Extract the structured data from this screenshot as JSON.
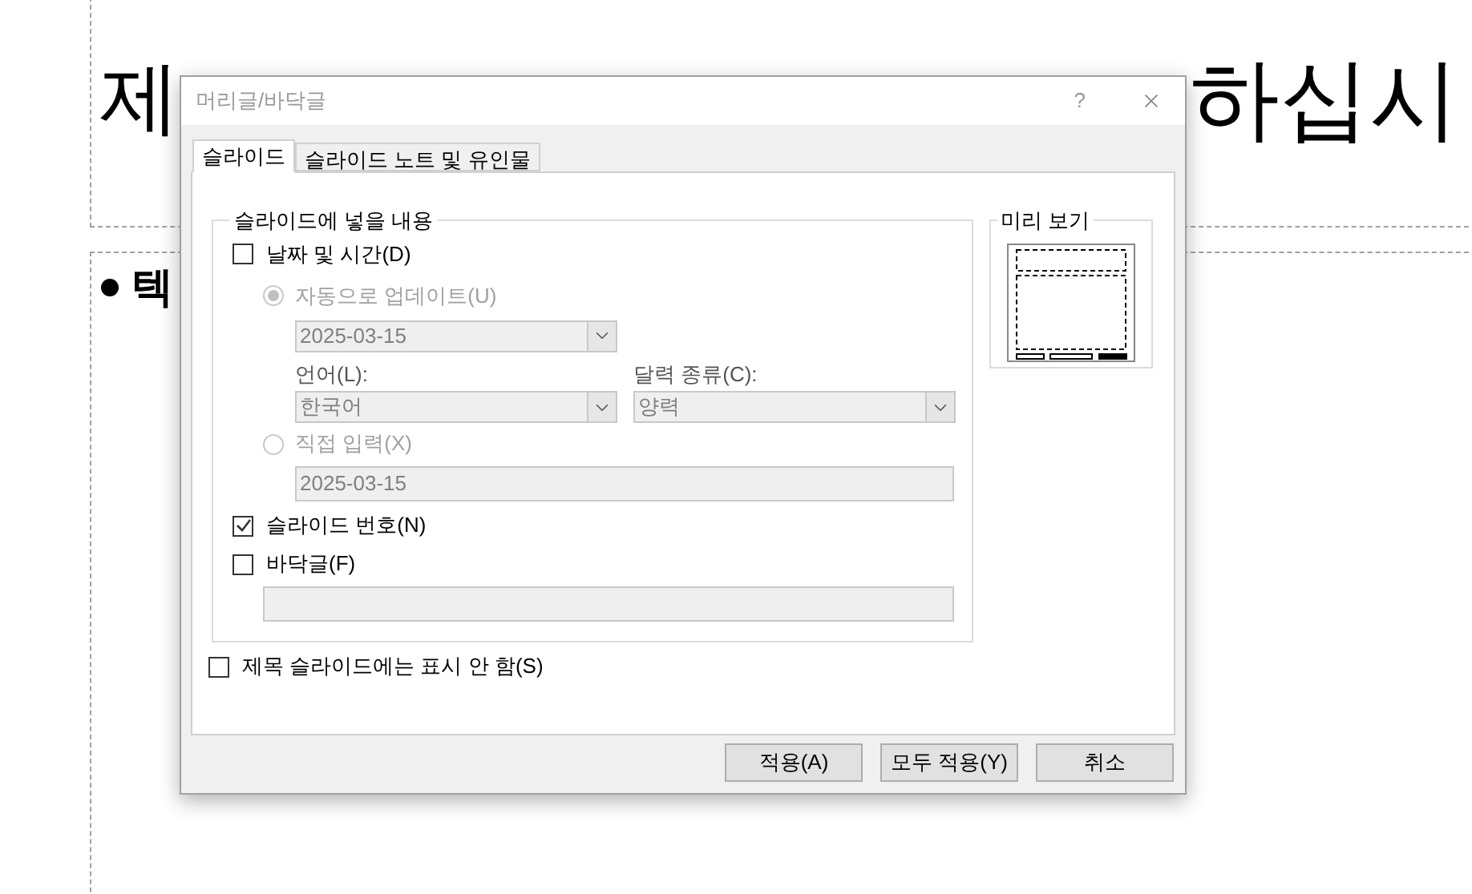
{
  "slide": {
    "title_left": "제",
    "title_right": "하십시",
    "body": "텍"
  },
  "window": {
    "title": "머리글/바닥글",
    "help": "?"
  },
  "tabs": [
    {
      "label": "슬라이드",
      "selected": true
    },
    {
      "label": "슬라이드 노트 및 유인물",
      "selected": false
    }
  ],
  "content_group": {
    "title": "슬라이드에 넣을 내용",
    "date_time": {
      "label": "날짜 및 시간(D)",
      "checked": false
    },
    "auto_update": {
      "label": "자동으로 업데이트(U)",
      "selected": true,
      "disabled": true,
      "date": "2025-03-15",
      "language_label": "언어(L):",
      "language": "한국어",
      "calendar_label": "달력 종류(C):",
      "calendar": "양력"
    },
    "fixed": {
      "label": "직접 입력(X)",
      "selected": false,
      "disabled": true,
      "value": "2025-03-15"
    },
    "slide_number": {
      "label": "슬라이드 번호(N)",
      "checked": true
    },
    "footer": {
      "label": "바닥글(F)",
      "checked": false
    }
  },
  "dont_show_on_title": {
    "label": "제목 슬라이드에는 표시 안 함(S)",
    "checked": false
  },
  "preview": {
    "title": "미리 보기"
  },
  "buttons": [
    "적용(A)",
    "모두 적용(Y)",
    "취소"
  ]
}
